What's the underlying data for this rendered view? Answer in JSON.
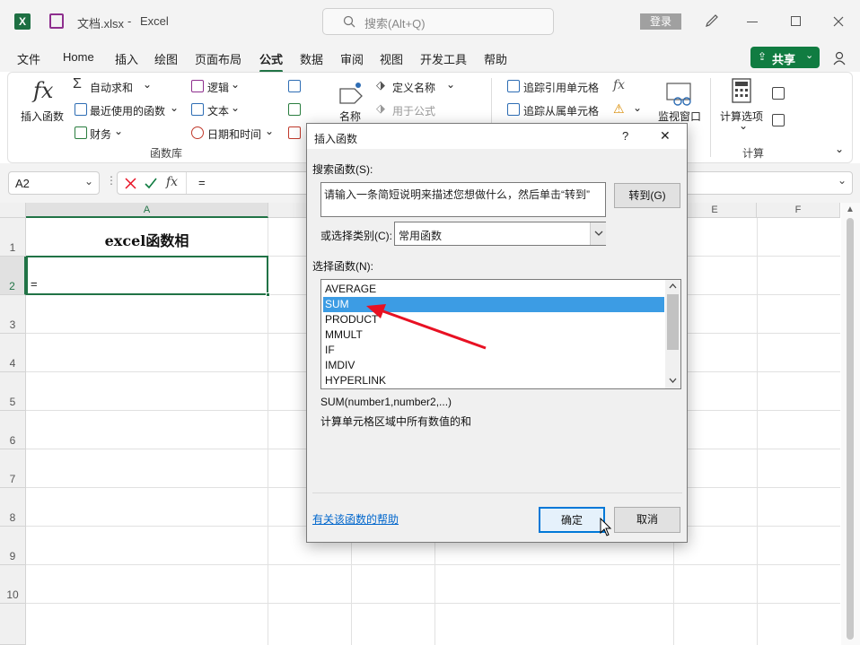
{
  "titlebar": {
    "file_name": "文档.xlsx",
    "separator": "-",
    "app_name": "Excel",
    "search_placeholder": "搜索(Alt+Q)",
    "login_label": "登录"
  },
  "menu": {
    "items": [
      "文件",
      "Home",
      "插入",
      "绘图",
      "页面布局",
      "公式",
      "数据",
      "审阅",
      "视图",
      "开发工具",
      "帮助"
    ],
    "active": "公式",
    "share_label": "共享"
  },
  "ribbon": {
    "insert_function": "插入函数",
    "autosum": "自动求和",
    "recent": "最近使用的函数",
    "financial": "财务",
    "logical": "逻辑",
    "text": "文本",
    "datetime": "日期和时间",
    "function_library": "函数库",
    "names": "名称",
    "define_name": "定义名称",
    "use_in_formula": "用于公式",
    "trace_precedents": "追踪引用单元格",
    "trace_dependents": "追踪从属单元格",
    "watch_window": "监视窗口",
    "calc_options": "计算选项",
    "calculation": "计算"
  },
  "formula_bar": {
    "name_box": "A2",
    "fx": "fx",
    "content": "="
  },
  "grid": {
    "columns": [
      "A",
      "E",
      "F"
    ],
    "rows": [
      "1",
      "2",
      "3",
      "4",
      "5",
      "6",
      "7",
      "8",
      "9",
      "10"
    ],
    "a1_value": "excel函数相",
    "a2_value": "="
  },
  "dialog": {
    "title": "插入函数",
    "help_glyph": "?",
    "close_glyph": "✕",
    "search_label": "搜索函数(S):",
    "search_text": "请输入一条简短说明来描述您想做什么，然后单击“转到”",
    "goto_label": "转到(G)",
    "category_label": "或选择类别(C):",
    "category_value": "常用函数",
    "select_label": "选择函数(N):",
    "functions": [
      "AVERAGE",
      "SUM",
      "PRODUCT",
      "MMULT",
      "IF",
      "IMDIV",
      "HYPERLINK"
    ],
    "selected_function": "SUM",
    "signature": "SUM(number1,number2,...)",
    "description": "计算单元格区域中所有数值的和",
    "help_link": "有关该函数的帮助",
    "ok_label": "确定",
    "cancel_label": "取消"
  },
  "annotation": {
    "arrow_color": "#e81123"
  }
}
